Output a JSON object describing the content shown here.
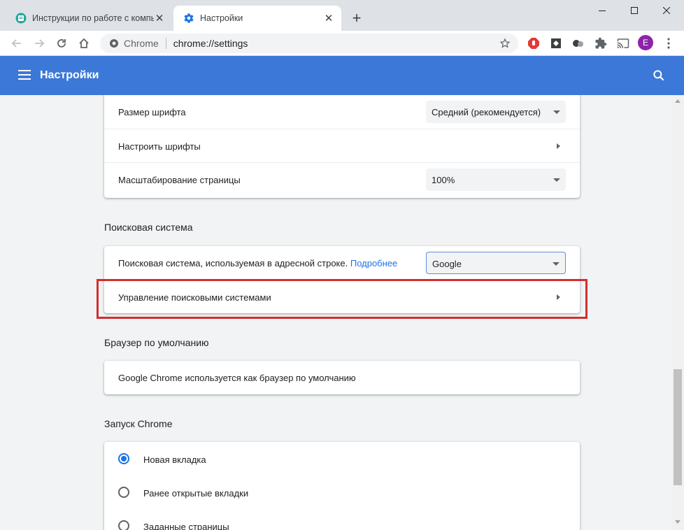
{
  "tabs": [
    {
      "title": "Инструкции по работе с компьютером",
      "active": false,
      "favicon": "page-favicon-icon"
    },
    {
      "title": "Настройки",
      "active": true,
      "favicon": "gear-icon"
    }
  ],
  "toolbar": {
    "site_chip": "Chrome",
    "url": "chrome://settings"
  },
  "profile": {
    "initial": "E",
    "color": "#8e24aa"
  },
  "header": {
    "title": "Настройки",
    "color": "#3c78d8"
  },
  "appearance": {
    "font_size_label": "Размер шрифта",
    "font_size_value": "Средний (рекомендуется)",
    "custom_fonts_label": "Настроить шрифты",
    "page_zoom_label": "Масштабирование страницы",
    "page_zoom_value": "100%"
  },
  "search_engine": {
    "section_title": "Поисковая система",
    "engine_label": "Поисковая система, используемая в адресной строке.",
    "learn_more": "Подробнее",
    "engine_value": "Google",
    "manage_label": "Управление поисковыми системами"
  },
  "default_browser": {
    "section_title": "Браузер по умолчанию",
    "status_text": "Google Chrome используется как браузер по умолчанию"
  },
  "on_startup": {
    "section_title": "Запуск Chrome",
    "options": [
      {
        "label": "Новая вкладка",
        "selected": true
      },
      {
        "label": "Ранее открытые вкладки",
        "selected": false
      },
      {
        "label": "Заданные страницы",
        "selected": false
      }
    ]
  },
  "annotation_color": "#d32f2f"
}
